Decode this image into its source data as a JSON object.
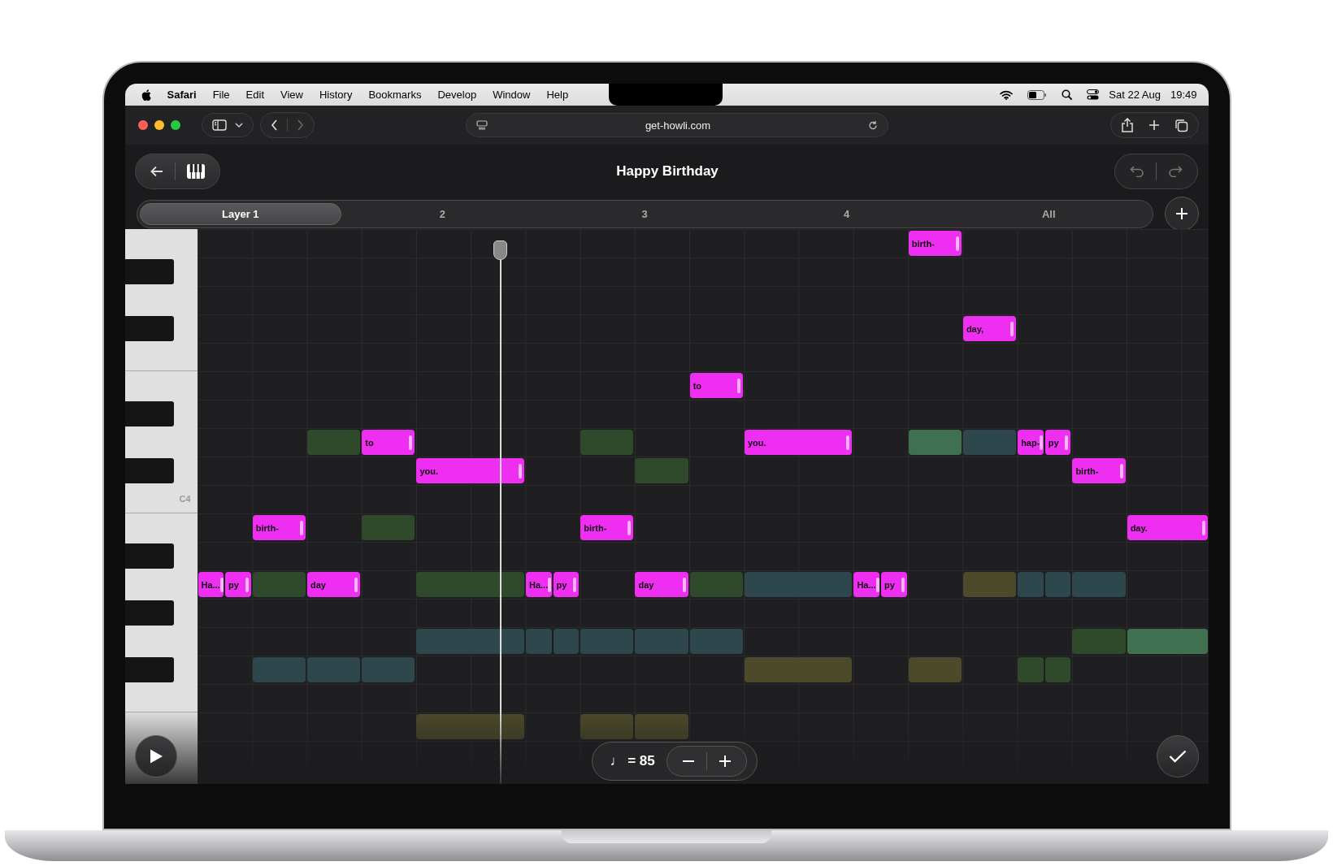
{
  "menu_bar": {
    "app": "Safari",
    "items": [
      "File",
      "Edit",
      "View",
      "History",
      "Bookmarks",
      "Develop",
      "Window",
      "Help"
    ],
    "date": "Sat 22 Aug",
    "time": "19:49"
  },
  "browser": {
    "url": "get-howli.com"
  },
  "header": {
    "title": "Happy Birthday"
  },
  "layers": [
    {
      "label": "Layer 1",
      "selected": true
    },
    {
      "label": "2",
      "selected": false
    },
    {
      "label": "3",
      "selected": false
    },
    {
      "label": "4",
      "selected": false
    },
    {
      "label": "All",
      "selected": false
    }
  ],
  "keyboard": {
    "label": "C4"
  },
  "lyric_notes": [
    {
      "text": "birth-"
    },
    {
      "text": "day,"
    },
    {
      "text": "to"
    },
    {
      "text": "to"
    },
    {
      "text": "you."
    },
    {
      "text": "hap-"
    },
    {
      "text": "py"
    },
    {
      "text": "you."
    },
    {
      "text": "birth-"
    },
    {
      "text": "birth-"
    },
    {
      "text": "birth-"
    },
    {
      "text": "day."
    },
    {
      "text": "Ha..."
    },
    {
      "text": "py"
    },
    {
      "text": "day"
    },
    {
      "text": "Ha..."
    },
    {
      "text": "py"
    },
    {
      "text": "day"
    },
    {
      "text": "Ha..."
    },
    {
      "text": "py"
    }
  ],
  "accompaniment_notes": [
    {
      "color": "#2f4a2a"
    },
    {
      "color": "#2f4a2a"
    },
    {
      "color": "#3f7150"
    },
    {
      "color": "#2e474c"
    },
    {
      "color": "#2f4a2a"
    },
    {
      "color": "#2f4a2a"
    },
    {
      "color": "#2f4a2a"
    },
    {
      "color": "#2f4a2a"
    },
    {
      "color": "#2f4a2a"
    },
    {
      "color": "#2e474c"
    },
    {
      "color": "#4c4a2a"
    },
    {
      "color": "#2e474c"
    },
    {
      "color": "#2e474c"
    },
    {
      "color": "#2e474c"
    },
    {
      "color": "#2e474c"
    },
    {
      "color": "#2e474c"
    },
    {
      "color": "#2e474c"
    },
    {
      "color": "#2e474c"
    },
    {
      "color": "#2e474c"
    },
    {
      "color": "#2e474c"
    },
    {
      "color": "#2f4a2a"
    },
    {
      "color": "#3f7150"
    },
    {
      "color": "#2e474c"
    },
    {
      "color": "#2e474c"
    },
    {
      "color": "#2e474c"
    },
    {
      "color": "#4c4a2a"
    },
    {
      "color": "#4c4a2a"
    },
    {
      "color": "#2f4a2a"
    },
    {
      "color": "#2f4a2a"
    },
    {
      "color": "#4c4a2a"
    },
    {
      "color": "#4c4a2a"
    },
    {
      "color": "#4c4a2a"
    }
  ],
  "tempo": {
    "note": "♩",
    "value": "= 85"
  }
}
